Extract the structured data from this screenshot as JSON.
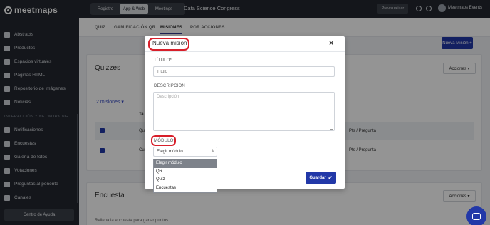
{
  "app": {
    "logo_text": "meetmaps"
  },
  "sidebar": {
    "items": [
      {
        "label": "Abstracts",
        "icon": "bookmark-icon"
      },
      {
        "label": "Productos",
        "icon": "box-icon"
      },
      {
        "label": "Espacios virtuales",
        "icon": "map-icon"
      },
      {
        "label": "Páginas HTML",
        "icon": "book-icon"
      },
      {
        "label": "Repositorio de imágenes",
        "icon": "folder-icon"
      },
      {
        "label": "Noticias",
        "icon": "newspaper-icon"
      }
    ],
    "section_label": "INTERACCIÓN Y NETWORKING",
    "section_items": [
      {
        "label": "Notificaciones",
        "icon": "bell-icon"
      },
      {
        "label": "Encuestas",
        "icon": "poll-icon"
      },
      {
        "label": "Galería de fotos",
        "icon": "image-icon"
      },
      {
        "label": "Votaciones",
        "icon": "vote-icon"
      },
      {
        "label": "Preguntas al ponente",
        "icon": "question-icon"
      },
      {
        "label": "Canales",
        "icon": "channel-icon"
      }
    ],
    "help_button": "Centro de Ayuda"
  },
  "topbar": {
    "nav": [
      "Registro",
      "App & Web",
      "Meetings"
    ],
    "active_nav": "App & Web",
    "event_name": "Data Science Congress",
    "preview_button": "Previsualizar",
    "user_name": "Meetmaps Events"
  },
  "tabs": {
    "items": [
      "QUIZ",
      "GAMIFICACIÓN QR",
      "MISIONES",
      "POR ACCIONES"
    ],
    "active": "MISIONES"
  },
  "main": {
    "new_mission_button": "Nueva Misión +",
    "quizzes_title": "Quizzes",
    "acciones_label": "Acciones ▾",
    "misiones_count": "2 misiones ▾",
    "col_ta": "Ta",
    "rows": [
      {
        "prefix": "Qu",
        "points": "Pts / Pregunta"
      },
      {
        "prefix": "Cu",
        "points": "Pts / Pregunta"
      }
    ],
    "encuesta_title": "Encuesta",
    "encuesta_note": "Rellena la encuesta para ganar puntos"
  },
  "modal": {
    "title": "Nueva misión",
    "close": "×",
    "titulo_label": "TÍTULO*",
    "titulo_placeholder": "Título",
    "descripcion_label": "DESCRIPCIÓN",
    "descripcion_placeholder": "Descripción",
    "modulo_label": "MÓDULO*",
    "modulo_selected": "Elegir módulo",
    "modulo_options": [
      "Elegir módulo",
      "QR",
      "Quiz",
      "Encuestas"
    ],
    "save_button": "Guardar",
    "save_icon": "check-icon"
  },
  "colors": {
    "accent": "#2238a8",
    "highlight": "#d81f2a",
    "sidebar_bg": "#23272f"
  }
}
